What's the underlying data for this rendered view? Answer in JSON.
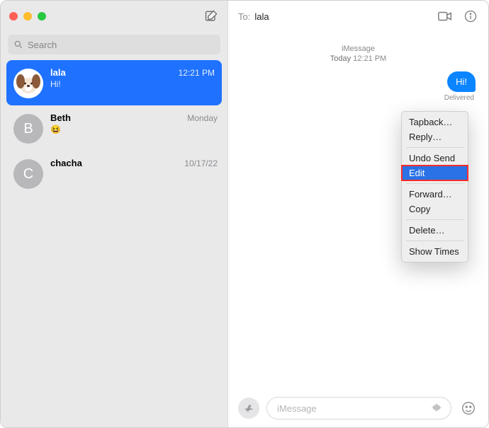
{
  "sidebar": {
    "search_placeholder": "Search",
    "conversations": [
      {
        "name": "lala",
        "time": "12:21 PM",
        "preview": "Hi!",
        "avatar": "dog"
      },
      {
        "name": "Beth",
        "time": "Monday",
        "preview": "😆",
        "avatar": "B"
      },
      {
        "name": "chacha",
        "time": "10/17/22",
        "preview": " ",
        "avatar": "C"
      }
    ]
  },
  "header": {
    "to_label": "To:",
    "to_name": "lala"
  },
  "thread": {
    "service": "iMessage",
    "ts_day": "Today",
    "ts_time": "12:21 PM",
    "bubble_text": "Hi!",
    "delivered_label": "Delivered"
  },
  "context_menu": {
    "items": [
      "Tapback…",
      "Reply…",
      "Undo Send",
      "Edit",
      "Forward…",
      "Copy",
      "Delete…",
      "Show Times"
    ],
    "highlighted_index": 3,
    "separators_after": [
      1,
      3,
      5,
      6
    ]
  },
  "compose": {
    "placeholder": "iMessage"
  }
}
